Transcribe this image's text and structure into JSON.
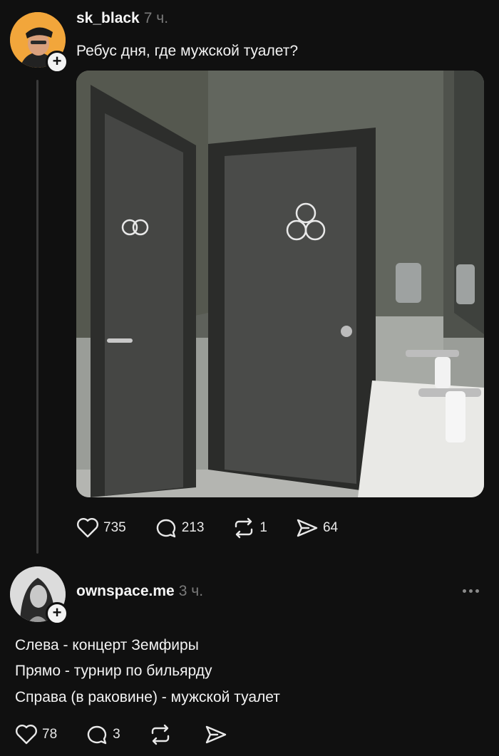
{
  "post": {
    "username": "sk_black",
    "time": "7 ч.",
    "text": "Ребус дня, где мужской туалет?",
    "photo_description_icon": "restroom-doors-photo",
    "stats": {
      "likes": "735",
      "comments": "213",
      "reposts": "1",
      "shares": "64"
    }
  },
  "reply": {
    "username": "ownspace.me",
    "time": "3 ч.",
    "lines": [
      "Слева - концерт Земфиры",
      "Прямо - турнир по бильярду",
      "Справа (в раковине) - мужской туалет"
    ],
    "stats": {
      "likes": "78",
      "comments": "3"
    }
  },
  "colors": {
    "background": "#101010",
    "text": "#f3f3f3",
    "muted": "#7a7a7a",
    "thread_line": "#3a3a3a"
  }
}
